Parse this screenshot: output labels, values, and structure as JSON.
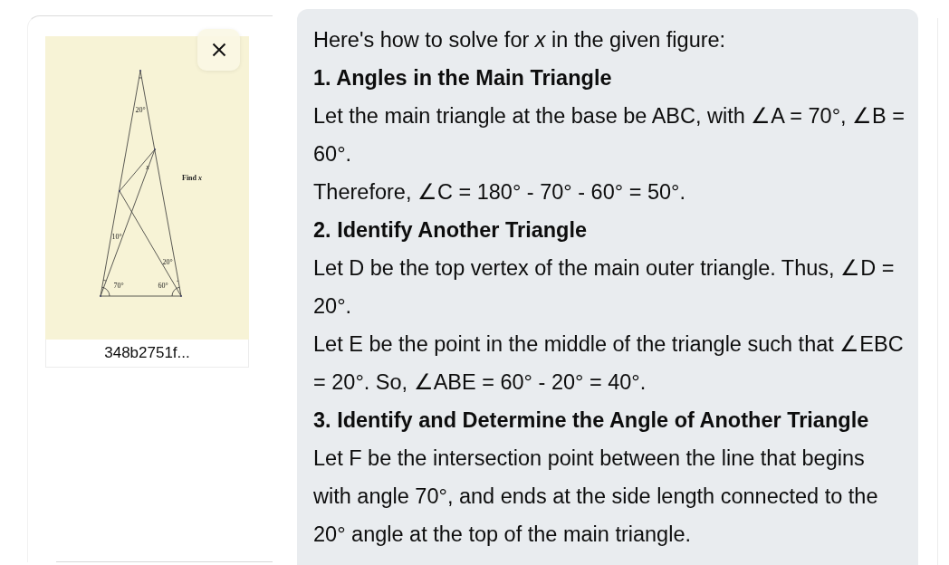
{
  "attachment": {
    "figure": {
      "labels": [
        {
          "kind": "angle",
          "text": "20°"
        },
        {
          "kind": "variable",
          "text": "x"
        },
        {
          "kind": "note",
          "text": "Find *x*"
        },
        {
          "kind": "angle",
          "text": "10°"
        },
        {
          "kind": "angle",
          "text": "20°"
        },
        {
          "kind": "angle",
          "text": "70°"
        },
        {
          "kind": "angle",
          "text": "60°"
        }
      ]
    },
    "caption": "348b2751f..."
  },
  "message": {
    "blocks": [
      {
        "kind": "paragraph",
        "text": "Here's how to solve for *x* in the given figure:"
      },
      {
        "kind": "heading",
        "text": "1. Angles in the Main Triangle"
      },
      {
        "kind": "paragraph",
        "text": "Let the main triangle at the base be ABC, with ∠A = 70°, ∠B = 60°."
      },
      {
        "kind": "paragraph",
        "text": "Therefore, ∠C = 180° - 70° - 60° = 50°."
      },
      {
        "kind": "heading",
        "text": "2. Identify Another Triangle"
      },
      {
        "kind": "paragraph",
        "text": "Let D be the top vertex of the main outer triangle. Thus, ∠D = 20°."
      },
      {
        "kind": "paragraph",
        "text": "Let E be the point in the middle of the triangle such that ∠EBC = 20°. So, ∠ABE = 60° - 20° = 40°."
      },
      {
        "kind": "heading",
        "text": "3. Identify and Determine the Angle of Another Triangle"
      },
      {
        "kind": "paragraph",
        "text": "Let F be the intersection point between the line that begins with angle 70°, and ends at the side length connected to the 20° angle at the top of the main triangle."
      }
    ]
  }
}
